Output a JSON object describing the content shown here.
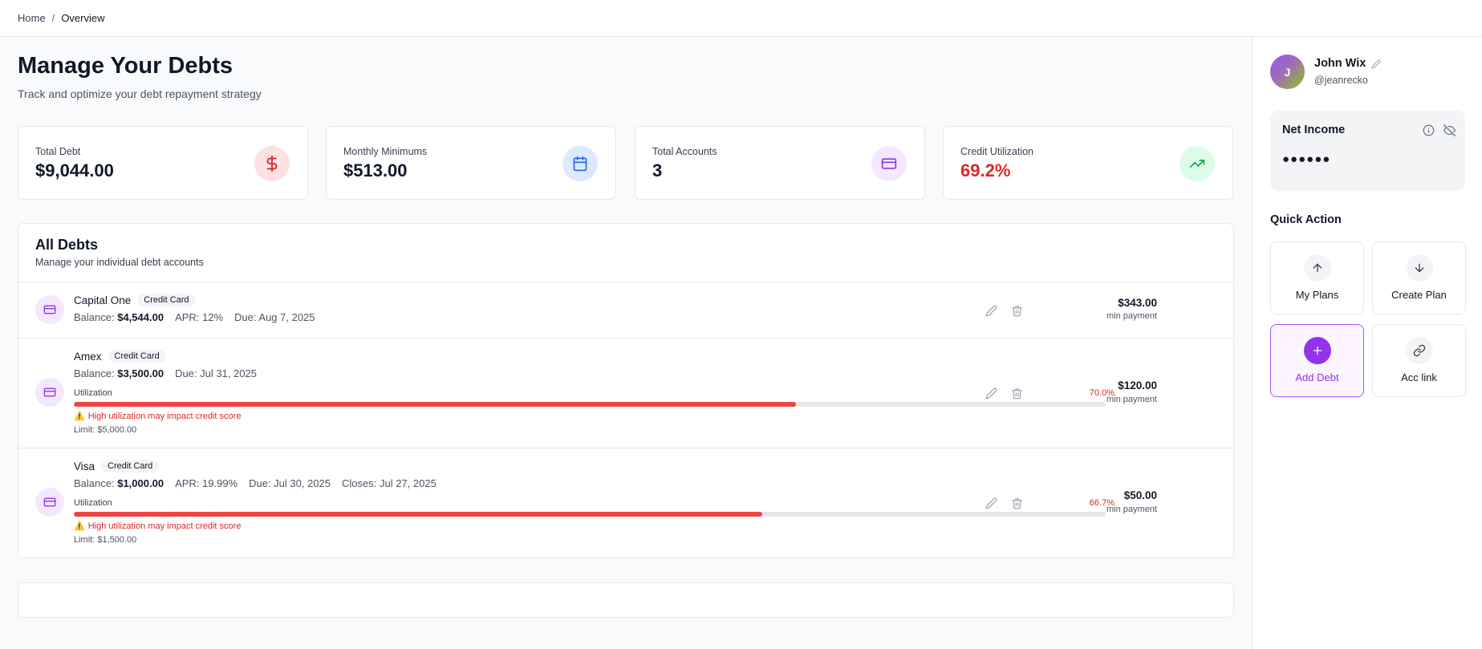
{
  "breadcrumb": {
    "home": "Home",
    "separator": "/",
    "current": "Overview"
  },
  "header": {
    "title": "Manage Your Debts",
    "subtitle": "Track and optimize your debt repayment strategy"
  },
  "stats": [
    {
      "label": "Total Debt",
      "value": "$9,044.00",
      "icon": "dollar-icon",
      "icon_bg": "#fee2e2",
      "icon_color": "#dc2626"
    },
    {
      "label": "Monthly Minimums",
      "value": "$513.00",
      "icon": "calendar-icon",
      "icon_bg": "#dbeafe",
      "icon_color": "#2563eb"
    },
    {
      "label": "Total Accounts",
      "value": "3",
      "icon": "credit-card-icon",
      "icon_bg": "#f3e8ff",
      "icon_color": "#9333ea"
    },
    {
      "label": "Credit Utilization",
      "value": "69.2%",
      "icon": "trending-up-icon",
      "icon_bg": "#dcfce7",
      "icon_color": "#16a34a",
      "value_color": "#dc2626"
    }
  ],
  "debts_panel": {
    "title": "All Debts",
    "subtitle": "Manage your individual debt accounts",
    "balance_label": "Balance:",
    "utilization_label": "Utilization",
    "min_payment_label": "min payment",
    "items": [
      {
        "name": "Capital One",
        "type": "Credit Card",
        "balance": "$4,544.00",
        "apr": "APR: 12%",
        "due": "Due: Aug 7, 2025",
        "min_payment": "$343.00"
      },
      {
        "name": "Amex",
        "type": "Credit Card",
        "balance": "$3,500.00",
        "due": "Due: Jul 31, 2025",
        "min_payment": "$120.00",
        "utilization": 0.7,
        "utilization_text": "70.0%",
        "warning": "High utilization may impact credit score",
        "limit": "Limit: $5,000.00"
      },
      {
        "name": "Visa",
        "type": "Credit Card",
        "balance": "$1,000.00",
        "apr": "APR: 19.99%",
        "due": "Due: Jul 30, 2025",
        "closes": "Closes: Jul 27, 2025",
        "min_payment": "$50.00",
        "utilization": 0.667,
        "utilization_text": "66.7%",
        "warning": "High utilization may impact credit score",
        "limit": "Limit: $1,500.00"
      }
    ]
  },
  "user": {
    "initial": "J",
    "name": "John Wix",
    "handle": "@jeanrecko"
  },
  "net_income": {
    "title": "Net Income",
    "masked_value": "●●●●●●"
  },
  "quick_action": {
    "title": "Quick Action",
    "buttons": [
      {
        "label": "My Plans",
        "icon": "arrow-up-icon"
      },
      {
        "label": "Create Plan",
        "icon": "arrow-down-icon"
      },
      {
        "label": "Add Debt",
        "icon": "plus-icon",
        "active": true
      },
      {
        "label": "Acc link",
        "icon": "link-icon"
      }
    ]
  },
  "colors": {
    "accent": "#9333ea",
    "danger": "#dc2626",
    "border": "#e5e7eb"
  }
}
